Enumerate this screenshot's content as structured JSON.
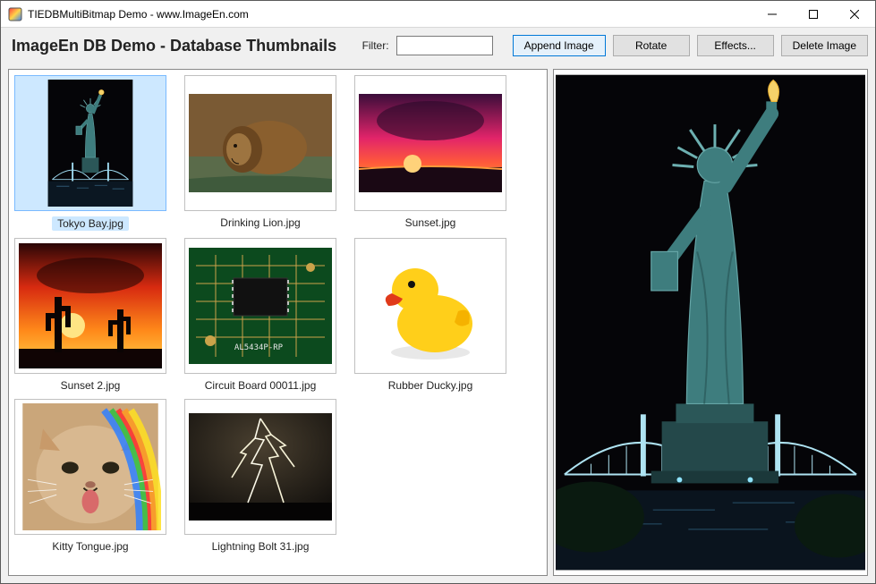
{
  "window": {
    "title": "TIEDBMultiBitmap Demo - www.ImageEn.com"
  },
  "toolbar": {
    "heading": "ImageEn DB Demo - Database Thumbnails",
    "filter_label": "Filter:",
    "filter_value": "",
    "filter_placeholder": "",
    "buttons": {
      "append": "Append Image",
      "rotate": "Rotate",
      "effects": "Effects...",
      "delete": "Delete Image"
    }
  },
  "thumbnails": [
    {
      "label": "Tokyo Bay.jpg",
      "selected": true,
      "kind": "tokyo"
    },
    {
      "label": "Drinking Lion.jpg",
      "selected": false,
      "kind": "lion"
    },
    {
      "label": "Sunset.jpg",
      "selected": false,
      "kind": "sunset1"
    },
    {
      "label": "Sunset 2.jpg",
      "selected": false,
      "kind": "sunset2"
    },
    {
      "label": "Circuit Board 00011.jpg",
      "selected": false,
      "kind": "circuit"
    },
    {
      "label": "Rubber Ducky.jpg",
      "selected": false,
      "kind": "ducky"
    },
    {
      "label": "Kitty Tongue.jpg",
      "selected": false,
      "kind": "kitty"
    },
    {
      "label": "Lightning Bolt 31.jpg",
      "selected": false,
      "kind": "lightning"
    }
  ],
  "preview": {
    "kind": "tokyo"
  }
}
